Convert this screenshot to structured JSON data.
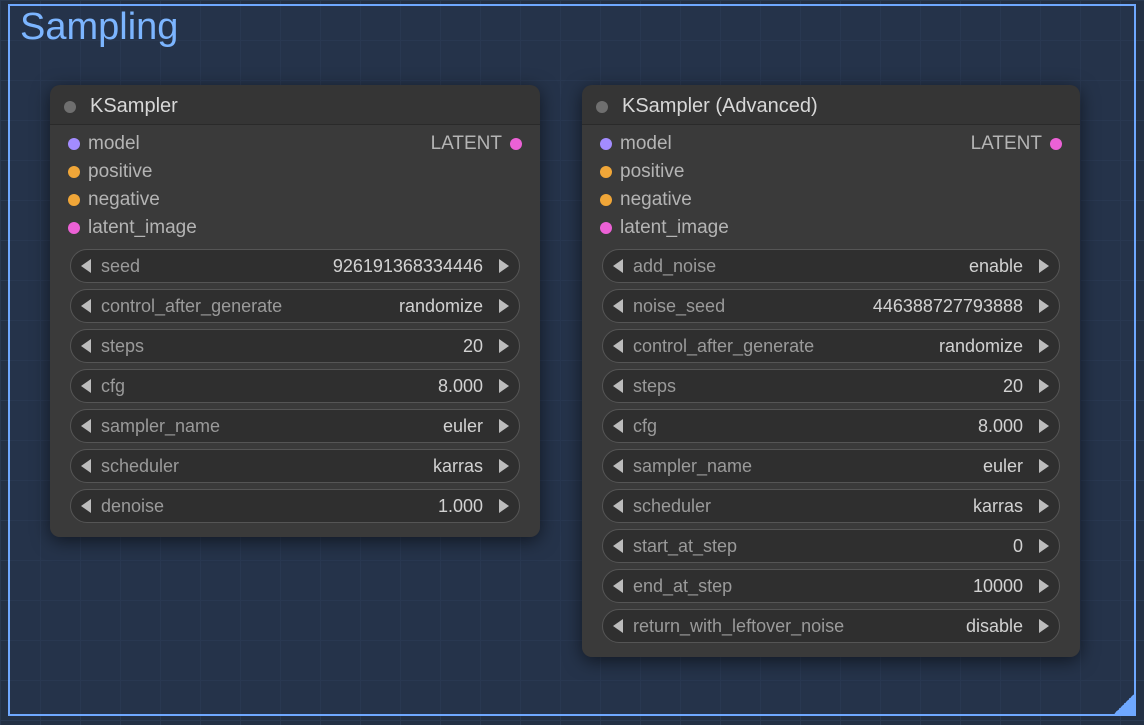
{
  "group": {
    "title": "Sampling"
  },
  "node_a": {
    "title": "KSampler",
    "inputs": {
      "model": "model",
      "positive": "positive",
      "negative": "negative",
      "latent_image": "latent_image"
    },
    "outputs": {
      "latent": "LATENT"
    },
    "widgets": {
      "seed": {
        "name": "seed",
        "value": "926191368334446"
      },
      "control_after_generate": {
        "name": "control_after_generate",
        "value": "randomize"
      },
      "steps": {
        "name": "steps",
        "value": "20"
      },
      "cfg": {
        "name": "cfg",
        "value": "8.000"
      },
      "sampler_name": {
        "name": "sampler_name",
        "value": "euler"
      },
      "scheduler": {
        "name": "scheduler",
        "value": "karras"
      },
      "denoise": {
        "name": "denoise",
        "value": "1.000"
      }
    }
  },
  "node_b": {
    "title": "KSampler (Advanced)",
    "inputs": {
      "model": "model",
      "positive": "positive",
      "negative": "negative",
      "latent_image": "latent_image"
    },
    "outputs": {
      "latent": "LATENT"
    },
    "widgets": {
      "add_noise": {
        "name": "add_noise",
        "value": "enable"
      },
      "noise_seed": {
        "name": "noise_seed",
        "value": "446388727793888"
      },
      "control_after_generate": {
        "name": "control_after_generate",
        "value": "randomize"
      },
      "steps": {
        "name": "steps",
        "value": "20"
      },
      "cfg": {
        "name": "cfg",
        "value": "8.000"
      },
      "sampler_name": {
        "name": "sampler_name",
        "value": "euler"
      },
      "scheduler": {
        "name": "scheduler",
        "value": "karras"
      },
      "start_at_step": {
        "name": "start_at_step",
        "value": "0"
      },
      "end_at_step": {
        "name": "end_at_step",
        "value": "10000"
      },
      "return_with_leftover_noise": {
        "name": "return_with_leftover_noise",
        "value": "disable"
      }
    }
  }
}
